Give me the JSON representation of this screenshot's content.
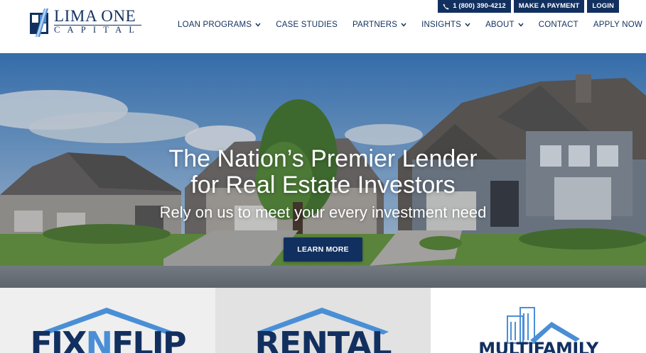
{
  "header": {
    "logo": {
      "name": "LIMA ONE",
      "sub": "CAPITAL"
    },
    "utility": {
      "phone": "1 (800) 390-4212",
      "payment": "MAKE A PAYMENT",
      "login": "LOGIN"
    },
    "nav": [
      {
        "label": "LOAN PROGRAMS",
        "dropdown": true
      },
      {
        "label": "CASE STUDIES",
        "dropdown": false
      },
      {
        "label": "PARTNERS",
        "dropdown": true
      },
      {
        "label": "INSIGHTS",
        "dropdown": true
      },
      {
        "label": "ABOUT",
        "dropdown": true
      },
      {
        "label": "CONTACT",
        "dropdown": false
      },
      {
        "label": "APPLY NOW",
        "dropdown": false
      }
    ]
  },
  "hero": {
    "title_line1": "The Nation’s Premier Lender",
    "title_line2": "for Real Estate Investors",
    "subtitle": "Rely on us to meet your every investment need",
    "cta": "LEARN MORE"
  },
  "programs": {
    "fix_flip": {
      "pre": "FIX",
      "mid": "N",
      "post": "FLIP"
    },
    "rental": {
      "label": "RENTAL"
    },
    "multifamily": {
      "label": "MULTIFAMILY"
    }
  },
  "colors": {
    "brand": "#12305f",
    "accent": "#4a8fd6"
  }
}
